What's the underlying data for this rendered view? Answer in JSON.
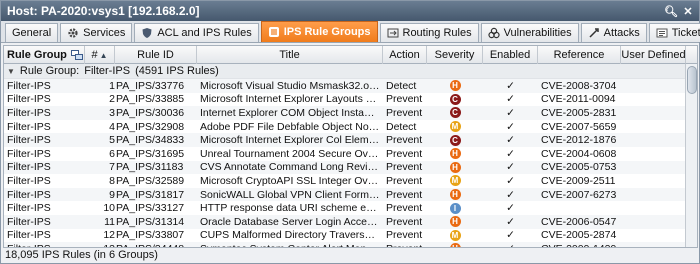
{
  "window": {
    "title": "Host: PA-2020:vsys1 [192.168.2.0]"
  },
  "tabs": [
    {
      "label": "General",
      "icon": "none",
      "active": false
    },
    {
      "label": "Services",
      "icon": "gear-icon",
      "active": false
    },
    {
      "label": "ACL and IPS Rules",
      "icon": "shield-icon",
      "active": false
    },
    {
      "label": "IPS Rule Groups",
      "icon": "ips-group-icon",
      "active": true
    },
    {
      "label": "Routing Rules",
      "icon": "routing-icon",
      "active": false
    },
    {
      "label": "Vulnerabilities",
      "icon": "biohazard-icon",
      "active": false
    },
    {
      "label": "Attacks",
      "icon": "attack-icon",
      "active": false
    },
    {
      "label": "Tickets",
      "icon": "ticket-icon",
      "active": false
    }
  ],
  "columns": {
    "group": "Rule Group",
    "num": "#",
    "rule_id": "Rule ID",
    "title": "Title",
    "action": "Action",
    "severity": "Severity",
    "enabled": "Enabled",
    "reference": "Reference",
    "user_defined": "User Defined"
  },
  "group_header": {
    "label": "Rule Group:",
    "name": "Filter-IPS",
    "count": "(4591 IPS Rules)"
  },
  "rows": [
    {
      "group": "Filter-IPS",
      "num": "1",
      "rule_id": "PA_IPS/33776",
      "title": "Microsoft Visual Studio Msmask32.ocx ...",
      "action": "Detect",
      "sev": "H",
      "enabled": "✓",
      "reference": "CVE-2008-3704"
    },
    {
      "group": "Filter-IPS",
      "num": "2",
      "rule_id": "PA_IPS/33885",
      "title": "Microsoft Internet Explorer Layouts Han...",
      "action": "Prevent",
      "sev": "C",
      "enabled": "✓",
      "reference": "CVE-2011-0094"
    },
    {
      "group": "Filter-IPS",
      "num": "3",
      "rule_id": "PA_IPS/30036",
      "title": "Internet Explorer COM Object Instantiati...",
      "action": "Prevent",
      "sev": "C",
      "enabled": "✓",
      "reference": "CVE-2005-2831"
    },
    {
      "group": "Filter-IPS",
      "num": "4",
      "rule_id": "PA_IPS/32908",
      "title": "Adobe PDF File Debfable Object Not end...",
      "action": "Detect",
      "sev": "M",
      "enabled": "✓",
      "reference": "CVE-2007-5659"
    },
    {
      "group": "Filter-IPS",
      "num": "5",
      "rule_id": "PA_IPS/34833",
      "title": "Microsoft Internet Explorer Col Element...",
      "action": "Prevent",
      "sev": "C",
      "enabled": "✓",
      "reference": "CVE-2012-1876"
    },
    {
      "group": "Filter-IPS",
      "num": "6",
      "rule_id": "PA_IPS/31695",
      "title": "Unreal Tournament 2004 Secure Overf...",
      "action": "Prevent",
      "sev": "H",
      "enabled": "✓",
      "reference": "CVE-2004-0608"
    },
    {
      "group": "Filter-IPS",
      "num": "7",
      "rule_id": "PA_IPS/31183",
      "title": "CVS Annotate Command Long Revisio...",
      "action": "Prevent",
      "sev": "H",
      "enabled": "✓",
      "reference": "CVE-2005-0753"
    },
    {
      "group": "Filter-IPS",
      "num": "8",
      "rule_id": "PA_IPS/32589",
      "title": "Microsoft CryptoAPI SSL Integer Overflo...",
      "action": "Prevent",
      "sev": "M",
      "enabled": "✓",
      "reference": "CVE-2009-2511"
    },
    {
      "group": "Filter-IPS",
      "num": "9",
      "rule_id": "PA_IPS/31817",
      "title": "SonicWALL Global VPN Client Format ...",
      "action": "Prevent",
      "sev": "H",
      "enabled": "✓",
      "reference": "CVE-2007-6273"
    },
    {
      "group": "Filter-IPS",
      "num": "10",
      "rule_id": "PA_IPS/33127",
      "title": "HTTP response data URI scheme eva...",
      "action": "Prevent",
      "sev": "I",
      "enabled": "✓",
      "reference": ""
    },
    {
      "group": "Filter-IPS",
      "num": "11",
      "rule_id": "PA_IPS/31314",
      "title": "Oracle Database Server Login Access ...",
      "action": "Prevent",
      "sev": "H",
      "enabled": "✓",
      "reference": "CVE-2006-0547"
    },
    {
      "group": "Filter-IPS",
      "num": "12",
      "rule_id": "PA_IPS/33807",
      "title": "CUPS Malformed Directory Traversal H...",
      "action": "Prevent",
      "sev": "M",
      "enabled": "✓",
      "reference": "CVE-2005-2874"
    },
    {
      "group": "Filter-IPS",
      "num": "13",
      "rule_id": "PA_IPS/34448",
      "title": "Symantec System Center Alert Manage...",
      "action": "Prevent",
      "sev": "H",
      "enabled": "✓",
      "reference": "CVE-2009-1429"
    }
  ],
  "severity_colors": {
    "C": "#8b1a1a",
    "H": "#ea6a12",
    "M": "#e8a316",
    "I": "#5b8fc8"
  },
  "status": "18,095 IPS Rules (in 6 Groups)"
}
